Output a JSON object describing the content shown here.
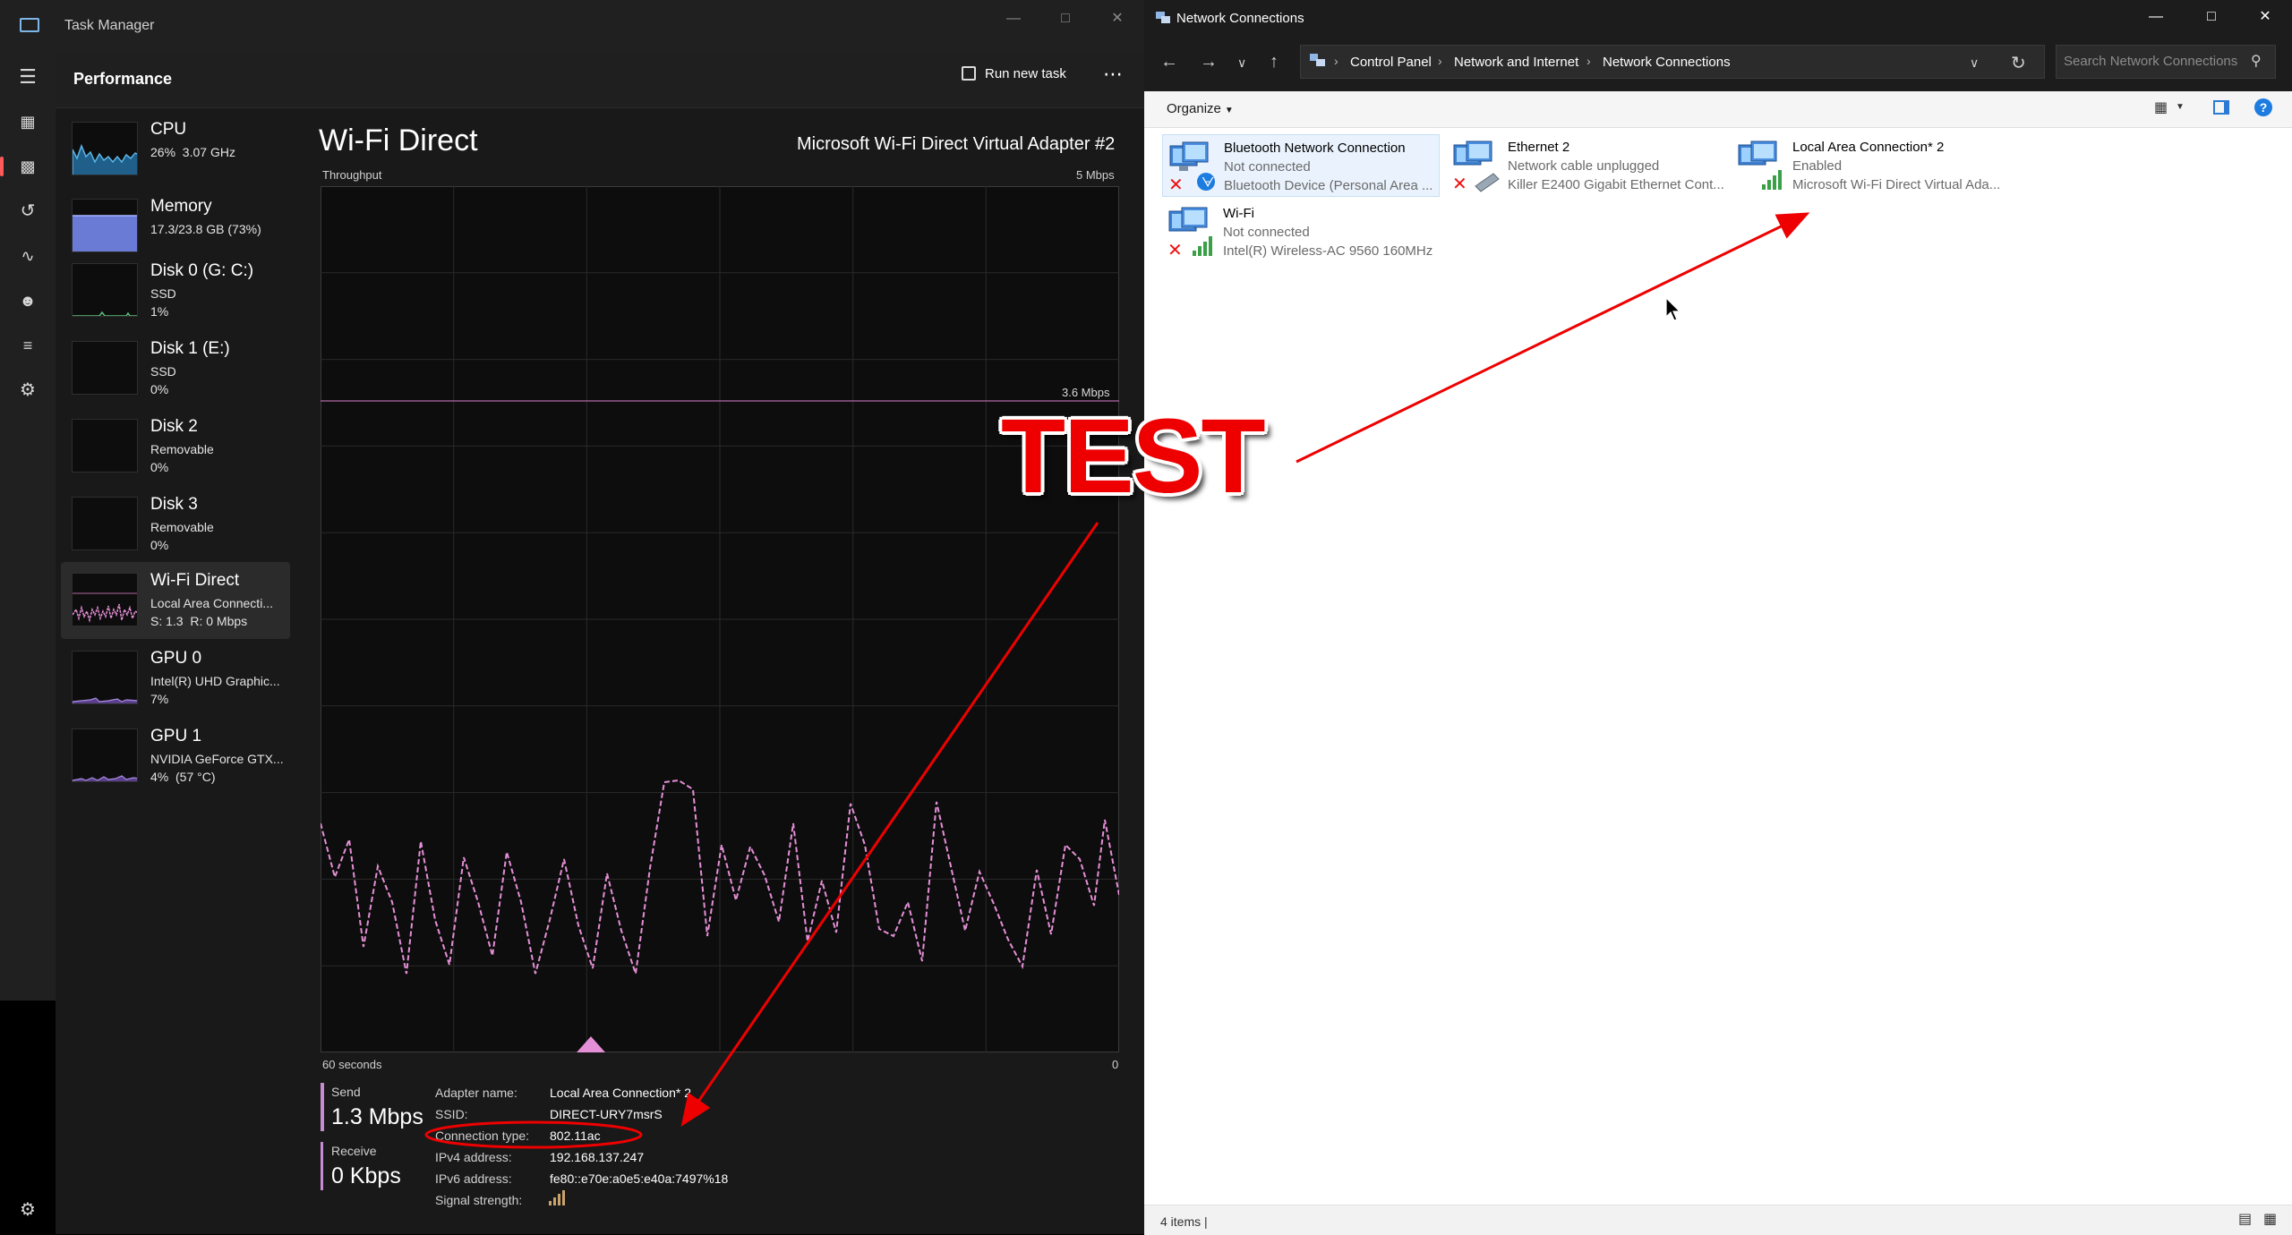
{
  "task_manager": {
    "window_title": "Task Manager",
    "section_title": "Performance",
    "run_new_task": "Run new task",
    "more": "⋯",
    "sidebar": [
      {
        "name": "CPU",
        "sub": "26%  3.07 GHz"
      },
      {
        "name": "Memory",
        "sub": "17.3/23.8 GB (73%)"
      },
      {
        "name": "Disk 0 (G: C:)",
        "sub": "SSD\n1%"
      },
      {
        "name": "Disk 1 (E:)",
        "sub": "SSD\n0%"
      },
      {
        "name": "Disk 2",
        "sub": "Removable\n0%"
      },
      {
        "name": "Disk 3",
        "sub": "Removable\n0%"
      },
      {
        "name": "Wi-Fi Direct",
        "sub": "Local Area Connecti...\nS: 1.3  R: 0 Mbps"
      },
      {
        "name": "GPU 0",
        "sub": "Intel(R) UHD Graphic...\n7%"
      },
      {
        "name": "GPU 1",
        "sub": "NVIDIA GeForce GTX...\n4%  (57 °C)"
      }
    ],
    "graph": {
      "title": "Wi-Fi Direct",
      "adapter": "Microsoft Wi-Fi Direct Virtual Adapter #2",
      "throughput_label": "Throughput",
      "axis_max": "5 Mbps",
      "marker_label": "3.6 Mbps",
      "axis_left": "60 seconds",
      "axis_right": "0",
      "line_color": "#e58fd6"
    },
    "send": {
      "label": "Send",
      "value": "1.3 Mbps"
    },
    "receive": {
      "label": "Receive",
      "value": "0 Kbps"
    },
    "properties": [
      {
        "key": "Adapter name:",
        "value": "Local Area Connection* 2"
      },
      {
        "key": "SSID:",
        "value": "DIRECT-URY7msrS"
      },
      {
        "key": "Connection type:",
        "value": "802.11ac"
      },
      {
        "key": "IPv4 address:",
        "value": "192.168.137.247"
      },
      {
        "key": "IPv6 address:",
        "value": "fe80::e70e:a0e5:e40a:7497%18"
      },
      {
        "key": "Signal strength:",
        "value": ""
      }
    ]
  },
  "explorer": {
    "window_title": "Network Connections",
    "breadcrumb": [
      "Control Panel",
      "Network and Internet",
      "Network Connections"
    ],
    "search_placeholder": "Search Network Connections",
    "organize": "Organize",
    "items": [
      {
        "name": "Bluetooth Network Connection",
        "status": "Not connected",
        "device": "Bluetooth Device (Personal Area ..."
      },
      {
        "name": "Ethernet 2",
        "status": "Network cable unplugged",
        "device": "Killer E2400 Gigabit Ethernet Cont..."
      },
      {
        "name": "Local Area Connection* 2",
        "status": "Enabled",
        "device": "Microsoft Wi-Fi Direct Virtual Ada..."
      },
      {
        "name": "Wi-Fi",
        "status": "Not connected",
        "device": "Intel(R) Wireless-AC 9560 160MHz"
      }
    ],
    "status_bar": "4 items  |"
  },
  "overlay": {
    "text": "TEST",
    "color": "#ee0000"
  }
}
